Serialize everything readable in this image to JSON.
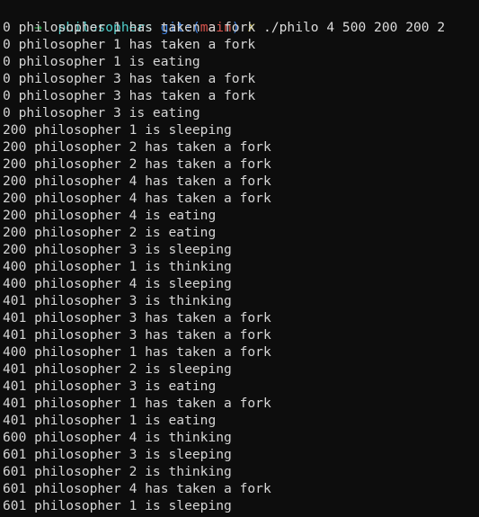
{
  "terminal": {
    "background_color": "#0d0d0d",
    "foreground_color": "#d6d6d6",
    "prompt": {
      "arrow": "→",
      "arrow_color": "#2fa84f",
      "directory": "philosophers",
      "directory_color": "#4ecdc9",
      "git_prefix": "git:(",
      "git_suffix": ")",
      "git_paren_color": "#3b7fe0",
      "branch": "main",
      "branch_color": "#d9544d",
      "status_mark": "✗",
      "status_mark_color": "#c2b339",
      "command": "./philo 4 500 200 200 2",
      "command_color": "#dcdcdc"
    },
    "output_lines": [
      "0 philosopher 1 has taken a fork",
      "0 philosopher 1 has taken a fork",
      "0 philosopher 1 is eating",
      "0 philosopher 3 has taken a fork",
      "0 philosopher 3 has taken a fork",
      "0 philosopher 3 is eating",
      "200 philosopher 1 is sleeping",
      "200 philosopher 2 has taken a fork",
      "200 philosopher 2 has taken a fork",
      "200 philosopher 4 has taken a fork",
      "200 philosopher 4 has taken a fork",
      "200 philosopher 4 is eating",
      "200 philosopher 2 is eating",
      "200 philosopher 3 is sleeping",
      "400 philosopher 1 is thinking",
      "400 philosopher 4 is sleeping",
      "401 philosopher 3 is thinking",
      "401 philosopher 3 has taken a fork",
      "401 philosopher 3 has taken a fork",
      "400 philosopher 1 has taken a fork",
      "401 philosopher 2 is sleeping",
      "401 philosopher 3 is eating",
      "401 philosopher 1 has taken a fork",
      "401 philosopher 1 is eating",
      "600 philosopher 4 is thinking",
      "601 philosopher 3 is sleeping",
      "601 philosopher 2 is thinking",
      "601 philosopher 4 has taken a fork",
      "601 philosopher 1 is sleeping"
    ]
  }
}
